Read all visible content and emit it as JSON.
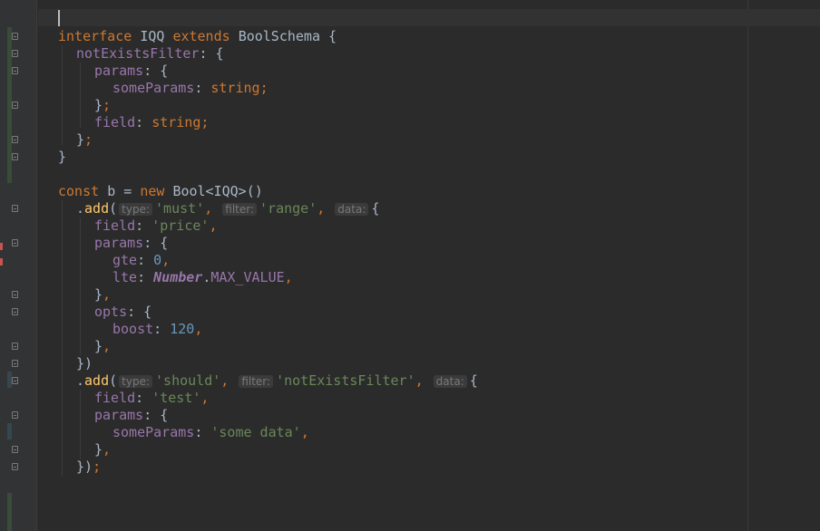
{
  "editor": {
    "colors": {
      "background": "#2b2b2b",
      "gutter": "#313335",
      "keyword": "#cc7832",
      "function": "#ffc66d",
      "property": "#9876aa",
      "string": "#6a8759",
      "number": "#6897bb",
      "default": "#a9b7c6"
    },
    "tokens": {
      "interface": "interface",
      "extends": "extends",
      "const": "const",
      "new": "new",
      "add": "add",
      "iqq": "IQQ",
      "boolschema": "BoolSchema",
      "notexistsfilter_prop": "notExistsFilter",
      "params": "params",
      "someparams": "someParams",
      "string_type": "string",
      "field": "field",
      "b": "b",
      "bool_generic": "Bool<IQQ>()",
      "hint_type": "type:",
      "hint_filter": "filter:",
      "hint_data": "data:",
      "str_must": "'must'",
      "str_range": "'range'",
      "str_price": "'price'",
      "gte": "gte",
      "zero": "0",
      "lte": "lte",
      "number_class": "Number",
      "max_value": "MAX_VALUE",
      "opts": "opts",
      "boost": "boost",
      "num_120": "120",
      "str_should": "'should'",
      "str_notexists": "'notExistsFilter'",
      "str_test": "'test'",
      "str_somedata": "'some data'"
    }
  }
}
